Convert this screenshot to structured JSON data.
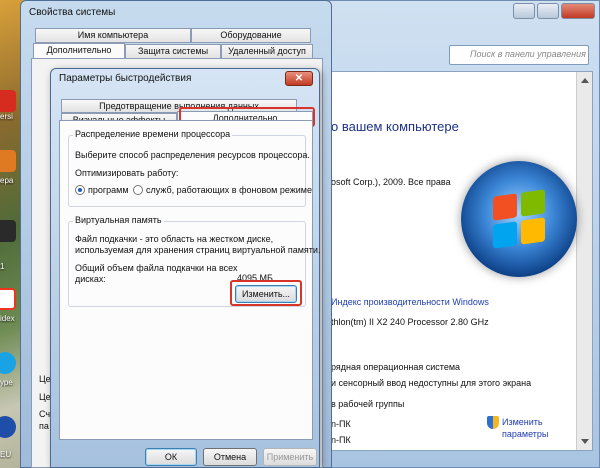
{
  "desktop": {
    "labels": [
      "ersi",
      "?)",
      "ера",
      "\\",
      "\\",
      "1",
      "іdex",
      "уре",
      "EU"
    ]
  },
  "control_panel": {
    "search_placeholder": "Поиск в панели управления",
    "heading": "о вашем компьютере",
    "copyright": "osoft Corp.), 2009. Все права",
    "perf_index_link": "Индекс производительности Windows",
    "processor": "thlon(tm) II X2 240 Processor   2.80 GHz",
    "os_type": "рядная операционная система",
    "pen_touch": "и сенсорный ввод недоступны для этого экрана",
    "workgroup_section": "в рабочей группы",
    "computer_name1": "n-ПК",
    "computer_name2": "n-ПК",
    "change_params_link1": "Изменить",
    "change_params_link2": "параметры"
  },
  "system_properties": {
    "title": "Свойства системы",
    "tabs_row1": [
      "Имя компьютера",
      "Оборудование"
    ],
    "tabs_row2": [
      "Дополнительно",
      "Защита системы",
      "Удаленный доступ"
    ],
    "side_text": [
      "Це",
      "Це",
      "Сч",
      "па"
    ]
  },
  "performance_options": {
    "title": "Параметры быстродействия",
    "close_glyph": "✕",
    "tab_dep": "Предотвращение выполнения данных",
    "tab_visual": "Визуальные эффекты",
    "tab_advanced": "Дополнительно",
    "cpu_group_title": "Распределение времени процессора",
    "cpu_desc": "Выберите способ распределения ресурсов процессора.",
    "optimize_label": "Оптимизировать работу:",
    "radio_programs": "программ",
    "radio_services": "служб, работающих в фоновом режиме",
    "vm_group_title": "Виртуальная память",
    "vm_desc1": "Файл подкачки - это область на жестком диске,",
    "vm_desc2": "используемая для хранения страниц виртуальной памяти.",
    "vm_total_label1": "Общий объем файла подкачки на всех",
    "vm_total_label2": "дисках:",
    "vm_total_value": "4095 МБ",
    "change_button": "Изменить...",
    "ok_button": "ОК",
    "cancel_button": "Отмена",
    "apply_button": "Применить"
  },
  "colors": {
    "highlight": "#d8342a",
    "link": "#1e3db4",
    "heading": "#1e3287"
  }
}
